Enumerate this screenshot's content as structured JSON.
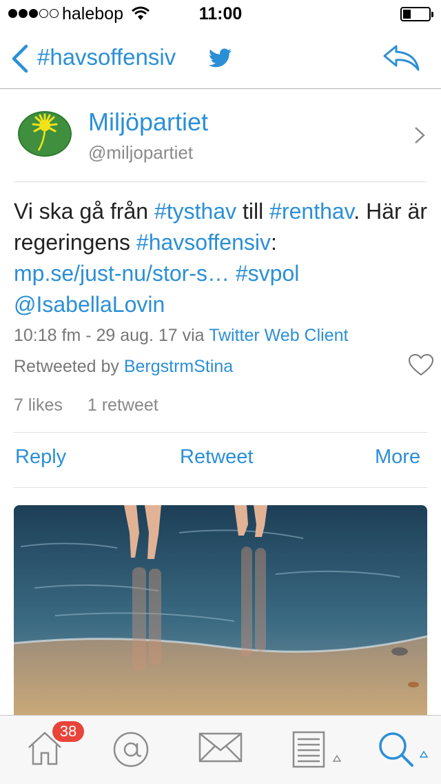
{
  "status_bar": {
    "carrier": "halebop",
    "time": "11:00",
    "signal_bars_filled": 3,
    "signal_bars_total": 5,
    "battery_level": 0.25
  },
  "nav": {
    "title": "#havsoffensiv",
    "back_icon": "chevron-left-icon",
    "logo_icon": "twitter-bird-icon",
    "action_icon": "reply-arrow-icon"
  },
  "tweet": {
    "author_name": "Miljöpartiet",
    "author_handle": "@miljopartiet",
    "text": {
      "t1": "Vi ska gå från ",
      "t2": "#tysthav",
      "t3": " till ",
      "t4": "#renthav",
      "t5": ". Här är regeringens ",
      "t6": "#havsoffensiv",
      "t7": ": ",
      "t8": "mp.se/just-nu/stor-s…",
      "t9": " ",
      "t10": "#svpol",
      "t11": " ",
      "t12": "@IsabellaLovin"
    },
    "timestamp": "10:18 fm - 29 aug. 17",
    "via_label": " via ",
    "client": "Twitter Web Client",
    "retweeted_by_label": "Retweeted by ",
    "retweeted_by_user": "BergstrmStina",
    "likes": "7 likes",
    "retweets": "1 retweet"
  },
  "actions": {
    "reply": "Reply",
    "retweet": "Retweet",
    "more": "More"
  },
  "tab_bar": {
    "home_badge": "38",
    "items": [
      "home-icon",
      "mentions-icon",
      "messages-icon",
      "lists-icon",
      "search-icon"
    ]
  },
  "colors": {
    "accent": "#2b8fd6",
    "badge": "#e8443a",
    "text": "#222222",
    "secondary": "#777777"
  }
}
